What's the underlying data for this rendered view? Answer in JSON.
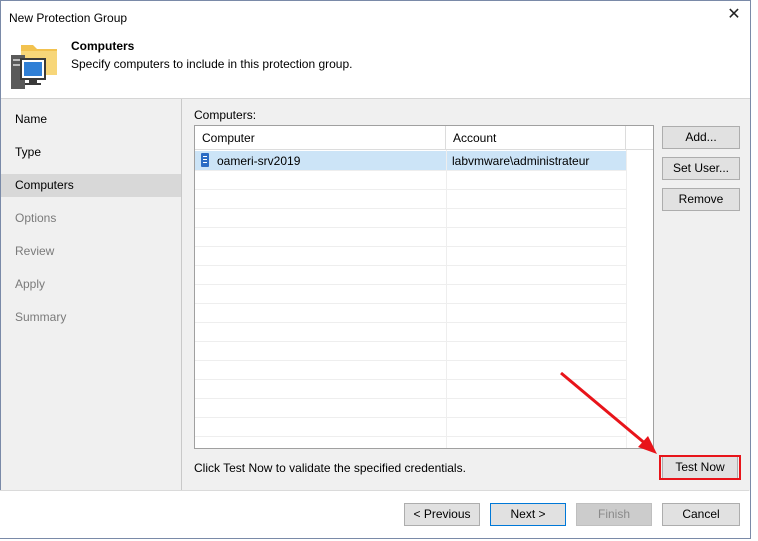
{
  "window": {
    "title": "New Protection Group",
    "close_icon": "close-icon"
  },
  "header": {
    "icon": "computer-folder-icon",
    "title": "Computers",
    "subtitle": "Specify computers to include in this protection group."
  },
  "sidebar": {
    "items": [
      {
        "label": "Name",
        "state": "enabled"
      },
      {
        "label": "Type",
        "state": "enabled"
      },
      {
        "label": "Computers",
        "state": "selected"
      },
      {
        "label": "Options",
        "state": "disabled"
      },
      {
        "label": "Review",
        "state": "disabled"
      },
      {
        "label": "Apply",
        "state": "disabled"
      },
      {
        "label": "Summary",
        "state": "disabled"
      }
    ]
  },
  "main": {
    "list_label": "Computers:",
    "columns": [
      "Computer",
      "Account"
    ],
    "rows": [
      {
        "computer": "oameri-srv2019",
        "account": "labvmware\\administrateur",
        "icon": "server-icon"
      }
    ],
    "buttons": {
      "add": "Add...",
      "set_user": "Set User...",
      "remove": "Remove",
      "test_now": "Test Now"
    },
    "hint": "Click Test Now to validate the specified credentials."
  },
  "footer": {
    "previous": "< Previous",
    "next": "Next >",
    "finish": "Finish",
    "cancel": "Cancel"
  },
  "annotation": {
    "color": "#e8141a"
  }
}
